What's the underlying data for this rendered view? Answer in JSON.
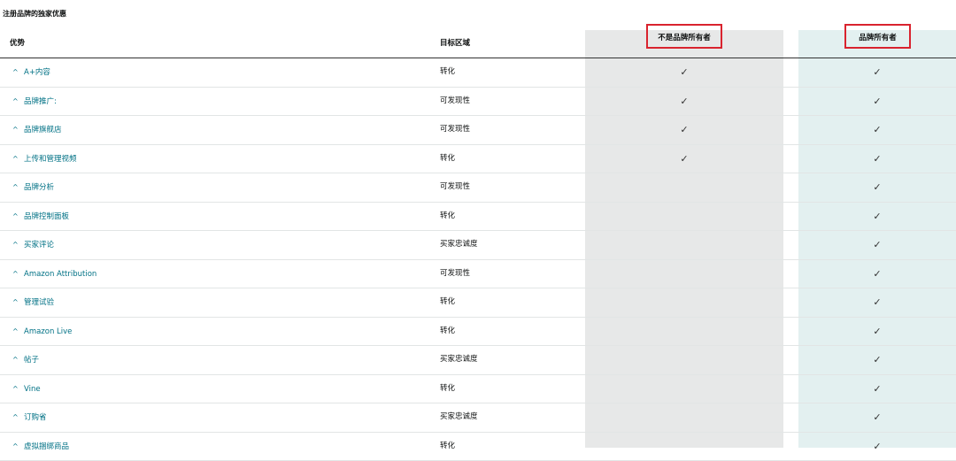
{
  "title": "注册品牌的独家优惠",
  "headers": {
    "advantage": "优势",
    "target": "目标区域",
    "non_owner": "不是品牌所有者",
    "owner": "品牌所有者"
  },
  "check_glyph": "✓",
  "expand_icon": "chevron-up-icon",
  "rows": [
    {
      "advantage": "A+内容",
      "target": "转化",
      "non_owner": true,
      "owner": true
    },
    {
      "advantage": "品牌推广:",
      "target": "可发现性",
      "non_owner": true,
      "owner": true
    },
    {
      "advantage": "品牌旗舰店",
      "target": "可发现性",
      "non_owner": true,
      "owner": true
    },
    {
      "advantage": "上传和管理视频",
      "target": "转化",
      "non_owner": true,
      "owner": true
    },
    {
      "advantage": "品牌分析",
      "target": "可发现性",
      "non_owner": false,
      "owner": true
    },
    {
      "advantage": "品牌控制面板",
      "target": "转化",
      "non_owner": false,
      "owner": true
    },
    {
      "advantage": "买家评论",
      "target": "买家忠诚度",
      "non_owner": false,
      "owner": true
    },
    {
      "advantage": "Amazon Attribution",
      "target": "可发现性",
      "non_owner": false,
      "owner": true
    },
    {
      "advantage": "管理试验",
      "target": "转化",
      "non_owner": false,
      "owner": true
    },
    {
      "advantage": "Amazon Live",
      "target": "转化",
      "non_owner": false,
      "owner": true
    },
    {
      "advantage": "帖子",
      "target": "买家忠诚度",
      "non_owner": false,
      "owner": true
    },
    {
      "advantage": "Vine",
      "target": "转化",
      "non_owner": false,
      "owner": true
    },
    {
      "advantage": "订购省",
      "target": "买家忠诚度",
      "non_owner": false,
      "owner": true
    },
    {
      "advantage": "虚拟捆绑商品",
      "target": "转化",
      "non_owner": false,
      "owner": true
    }
  ]
}
